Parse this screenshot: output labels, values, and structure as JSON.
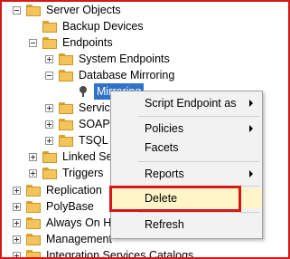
{
  "tree": {
    "server_objects": "Server Objects",
    "backup_devices": "Backup Devices",
    "endpoints": "Endpoints",
    "system_endpoints": "System Endpoints",
    "database_mirroring": "Database Mirroring",
    "mirroring_item": "Mirroring",
    "service_broker": "Service Broker",
    "soap": "SOAP",
    "tsql": "TSQL",
    "linked_servers": "Linked Servers",
    "triggers": "Triggers",
    "replication": "Replication",
    "polybase": "PolyBase",
    "always_on": "Always On High Availability",
    "management": "Management",
    "integration_services": "Integration Services Catalogs"
  },
  "context_menu": {
    "script_endpoint": "Script Endpoint as",
    "policies": "Policies",
    "facets": "Facets",
    "reports": "Reports",
    "delete": "Delete",
    "refresh": "Refresh"
  },
  "colors": {
    "highlight_border": "#d41818",
    "selection": "#3072c8",
    "menu_background": "#f2f2f2",
    "hover_background": "#fff5c9"
  }
}
